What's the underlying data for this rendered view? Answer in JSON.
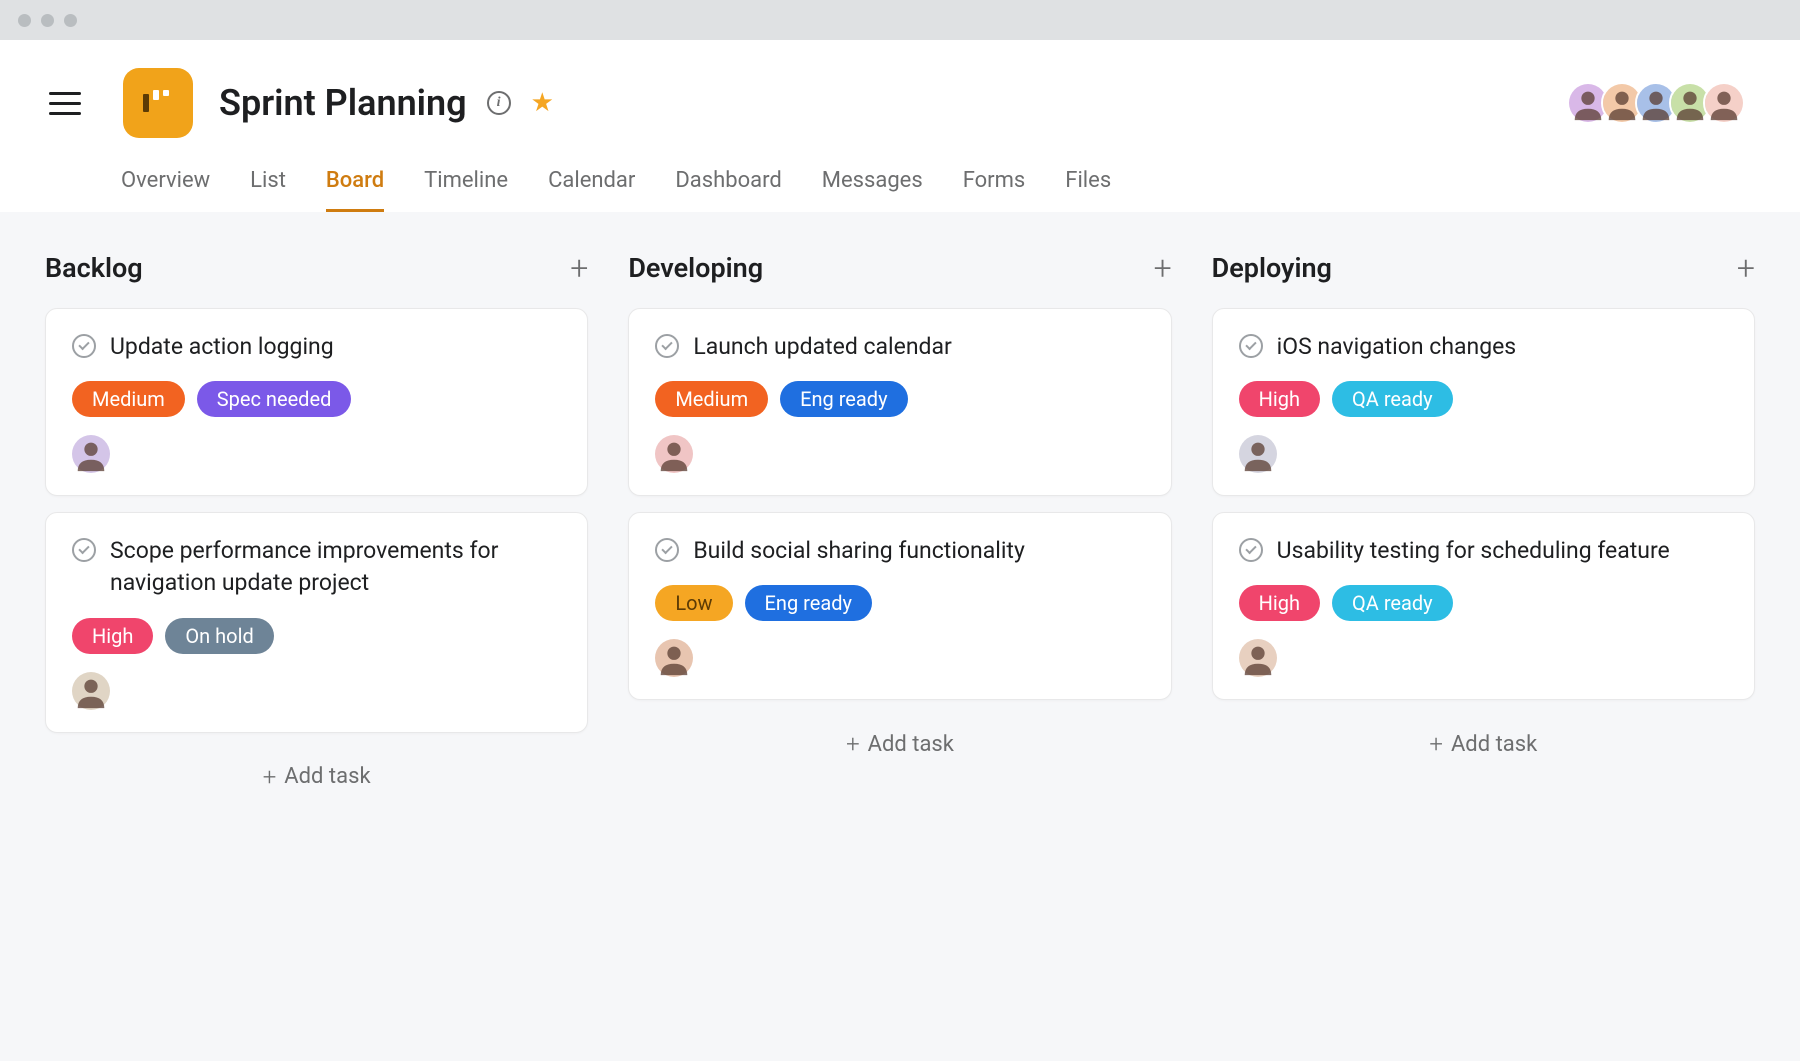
{
  "project": {
    "title": "Sprint Planning",
    "starred": true
  },
  "tabs": [
    {
      "label": "Overview",
      "active": false
    },
    {
      "label": "List",
      "active": false
    },
    {
      "label": "Board",
      "active": true
    },
    {
      "label": "Timeline",
      "active": false
    },
    {
      "label": "Calendar",
      "active": false
    },
    {
      "label": "Dashboard",
      "active": false
    },
    {
      "label": "Messages",
      "active": false
    },
    {
      "label": "Forms",
      "active": false
    },
    {
      "label": "Files",
      "active": false
    }
  ],
  "members": [
    {
      "name": "member-1",
      "bg": "#d9b8e8"
    },
    {
      "name": "member-2",
      "bg": "#f3c9a8"
    },
    {
      "name": "member-3",
      "bg": "#a8c0e8"
    },
    {
      "name": "member-4",
      "bg": "#c8e0a8"
    },
    {
      "name": "member-5",
      "bg": "#f5d0c8"
    }
  ],
  "columns": [
    {
      "title": "Backlog",
      "add_label": "Add task",
      "cards": [
        {
          "title": "Update action logging",
          "tags": [
            {
              "label": "Medium",
              "class": "tag-medium"
            },
            {
              "label": "Spec needed",
              "class": "tag-spec"
            }
          ],
          "assignee_bg": "#d4c5e8"
        },
        {
          "title": "Scope performance improvements for navigation update project",
          "tags": [
            {
              "label": "High",
              "class": "tag-high"
            },
            {
              "label": "On hold",
              "class": "tag-hold"
            }
          ],
          "assignee_bg": "#e0d5c5"
        }
      ]
    },
    {
      "title": "Developing",
      "add_label": "Add task",
      "cards": [
        {
          "title": "Launch updated calendar",
          "tags": [
            {
              "label": "Medium",
              "class": "tag-medium"
            },
            {
              "label": "Eng ready",
              "class": "tag-eng"
            }
          ],
          "assignee_bg": "#f0c5c5"
        },
        {
          "title": "Build social sharing functionality",
          "tags": [
            {
              "label": "Low",
              "class": "tag-low"
            },
            {
              "label": "Eng ready",
              "class": "tag-eng"
            }
          ],
          "assignee_bg": "#e8c5b0"
        }
      ]
    },
    {
      "title": "Deploying",
      "add_label": "Add task",
      "cards": [
        {
          "title": "iOS navigation changes",
          "tags": [
            {
              "label": "High",
              "class": "tag-high"
            },
            {
              "label": "QA ready",
              "class": "tag-qa"
            }
          ],
          "assignee_bg": "#d5d5e0"
        },
        {
          "title": "Usability testing for scheduling feature",
          "tags": [
            {
              "label": "High",
              "class": "tag-high"
            },
            {
              "label": "QA ready",
              "class": "tag-qa"
            }
          ],
          "assignee_bg": "#e8d0c0"
        }
      ]
    }
  ]
}
